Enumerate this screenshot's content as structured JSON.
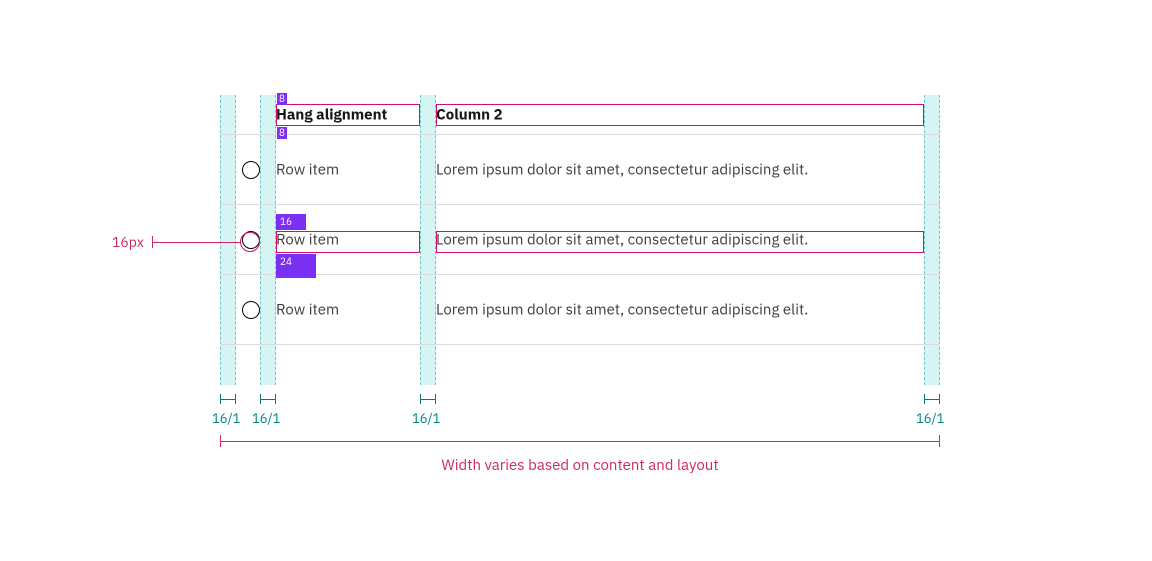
{
  "table": {
    "header": {
      "col1": "Hang alignment",
      "col2": "Column 2"
    },
    "rows": [
      {
        "col1": "Row item",
        "col2": "Lorem ipsum dolor sit amet, consectetur adipiscing elit."
      },
      {
        "col1": "Row item",
        "col2": "Lorem ipsum dolor sit amet, consectetur adipiscing elit."
      },
      {
        "col1": "Row item",
        "col2": "Lorem ipsum dolor sit amet, consectetur adipiscing elit."
      }
    ]
  },
  "spacing_chips": {
    "top_8": "8",
    "bottom_8": "8",
    "mid_16": "16",
    "mid_24": "24"
  },
  "measurements": {
    "g1": "16/1",
    "g2": "16/1",
    "g3": "16/1",
    "g4": "16/1"
  },
  "radio_callout": "16px",
  "fullwidth_caption": "Width varies based on content and layout"
}
